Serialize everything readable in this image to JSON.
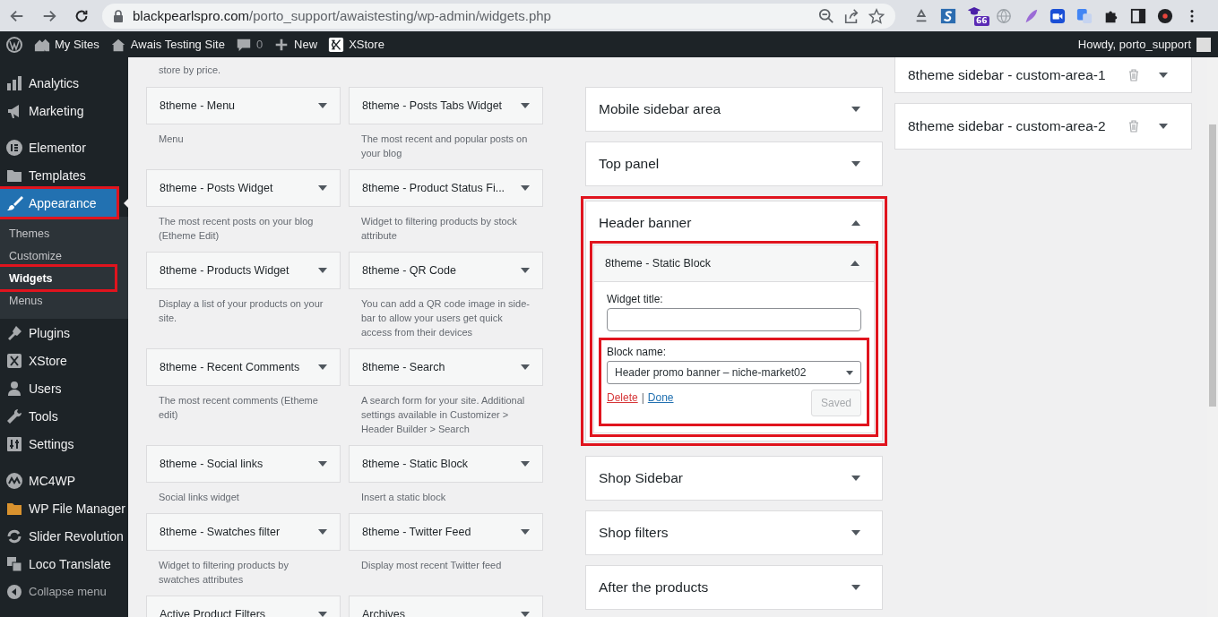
{
  "browser": {
    "url_host": "blackpearlspro.com",
    "url_path": "/porto_support/awaistesting/wp-admin/widgets.php",
    "extension_badge": "66"
  },
  "admin_bar": {
    "items": [
      {
        "kind": "my-sites",
        "label": "My Sites"
      },
      {
        "kind": "site",
        "label": "Awais Testing Site"
      },
      {
        "kind": "comments",
        "label": "0"
      },
      {
        "kind": "new",
        "label": "New"
      },
      {
        "kind": "xstore",
        "label": "XStore"
      }
    ],
    "greeting": "Howdy, porto_support"
  },
  "sidebar": {
    "items": [
      {
        "kind": "item",
        "label": "Analytics",
        "selected": false,
        "highlighted": false
      },
      {
        "kind": "item",
        "label": "Marketing",
        "selected": false,
        "highlighted": false
      },
      {
        "kind": "separator"
      },
      {
        "kind": "item",
        "label": "Elementor",
        "selected": false,
        "highlighted": false
      },
      {
        "kind": "item",
        "label": "Templates",
        "selected": false,
        "highlighted": false
      },
      {
        "kind": "item",
        "label": "Appearance",
        "selected": true,
        "highlighted": true
      },
      {
        "kind": "sub",
        "label": "Themes",
        "selected": false,
        "highlighted": false
      },
      {
        "kind": "sub",
        "label": "Customize",
        "selected": false,
        "highlighted": false
      },
      {
        "kind": "sub",
        "label": "Widgets",
        "selected": true,
        "highlighted": true
      },
      {
        "kind": "sub",
        "label": "Menus",
        "selected": false,
        "highlighted": false
      },
      {
        "kind": "item",
        "label": "Plugins",
        "selected": false,
        "highlighted": false
      },
      {
        "kind": "item",
        "label": "XStore",
        "selected": false,
        "highlighted": false
      },
      {
        "kind": "item",
        "label": "Users",
        "selected": false,
        "highlighted": false
      },
      {
        "kind": "item",
        "label": "Tools",
        "selected": false,
        "highlighted": false
      },
      {
        "kind": "item",
        "label": "Settings",
        "selected": false,
        "highlighted": false
      },
      {
        "kind": "separator"
      },
      {
        "kind": "item",
        "label": "MC4WP",
        "selected": false,
        "highlighted": false
      },
      {
        "kind": "item",
        "label": "WP File Manager",
        "selected": false,
        "highlighted": false
      },
      {
        "kind": "item",
        "label": "Slider Revolution",
        "selected": false,
        "highlighted": false
      },
      {
        "kind": "item",
        "label": "Loco Translate",
        "selected": false,
        "highlighted": false
      },
      {
        "kind": "collapse",
        "label": "Collapse menu"
      }
    ]
  },
  "available_widgets": {
    "top_description": "store by price.",
    "rows": [
      [
        {
          "title": "8theme - Menu",
          "description": "Menu"
        },
        {
          "title": "8theme - Posts Tabs Widget",
          "description": "The most recent and popular posts on your blog"
        }
      ],
      [
        {
          "title": "8theme - Posts Widget",
          "description": "The most recent posts on your blog (Etheme Edit)"
        },
        {
          "title": "8theme - Product Status Fi...",
          "description": "Widget to filtering products by stock attribute"
        }
      ],
      [
        {
          "title": "8theme - Products Widget",
          "description": "Display a list of your products on your site."
        },
        {
          "title": "8theme - QR Code",
          "description": "You can add a QR code image in side-bar to allow your users get quick access from their devices"
        }
      ],
      [
        {
          "title": "8theme - Recent Comments",
          "description": "The most recent comments (Etheme edit)"
        },
        {
          "title": "8theme - Search",
          "description": "A search form for your site. Additional settings available in Customizer > Header Builder > Search"
        }
      ],
      [
        {
          "title": "8theme - Social links",
          "description": "Social links widget"
        },
        {
          "title": "8theme - Static Block",
          "description": "Insert a static block"
        }
      ],
      [
        {
          "title": "8theme - Swatches filter",
          "description": "Widget to filtering products by swatches attributes"
        },
        {
          "title": "8theme - Twitter Feed",
          "description": "Display most recent Twitter feed"
        }
      ],
      [
        {
          "title": "Active Product Filters"
        },
        {
          "title": "Archives"
        }
      ]
    ]
  },
  "widget_areas": [
    {
      "title": "Mobile sidebar area",
      "expanded": false
    },
    {
      "title": "Top panel",
      "expanded": false
    },
    {
      "title": "Header banner",
      "expanded": true,
      "highlighted": true,
      "widget": {
        "title": "8theme - Static Block",
        "expanded": true,
        "highlighted": true,
        "title_label": "Widget title:",
        "block_label": "Block name:",
        "block_value": "Header promo banner – niche-market02",
        "block_highlighted": true,
        "delete": "Delete",
        "separator": "|",
        "done": "Done",
        "save": "Saved",
        "save_disabled": true
      }
    },
    {
      "title": "Shop Sidebar",
      "expanded": false
    },
    {
      "title": "Shop filters",
      "expanded": false
    },
    {
      "title": "After the products",
      "expanded": false
    }
  ],
  "custom_areas": [
    {
      "title": "8theme sidebar - custom-area-1",
      "expanded": false
    },
    {
      "title": "8theme sidebar - custom-area-2",
      "expanded": false
    }
  ]
}
